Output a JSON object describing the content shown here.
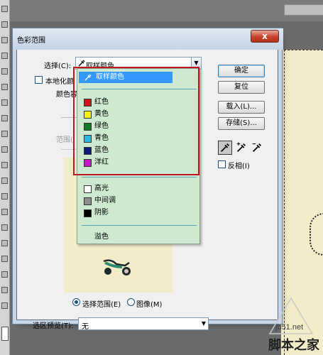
{
  "dialog": {
    "title": "色彩范围",
    "close_label": "x",
    "select_label": "选择(C):",
    "select_value": "取样颜色",
    "localize_label": "本地化颜",
    "fuzz_label": "颜色容",
    "range_label": "范围(",
    "radio_selection_label": "选择范围(E)",
    "radio_image_label": "图像(M)",
    "preview_label": "选区预览(T):",
    "preview_value": "无",
    "invert_label": "反相(I)"
  },
  "buttons": {
    "ok": "确定",
    "reset": "复位",
    "load": "载入(L)...",
    "save": "存储(S)..."
  },
  "dropdown": {
    "selected": "取样颜色",
    "colors": [
      {
        "label": "红色",
        "color": "#d4141c"
      },
      {
        "label": "黄色",
        "color": "#f5f01a"
      },
      {
        "label": "绿色",
        "color": "#0f7a23"
      },
      {
        "label": "青色",
        "color": "#27b8e3"
      },
      {
        "label": "蓝色",
        "color": "#0f1c7a"
      },
      {
        "label": "洋红",
        "color": "#c418c4"
      }
    ],
    "tones": [
      {
        "label": "高光",
        "color": "#ffffff"
      },
      {
        "label": "中间调",
        "color": "#8c8c8c"
      },
      {
        "label": "阴影",
        "color": "#000000"
      }
    ],
    "out_of_gamut": "溢色"
  },
  "watermark": {
    "url": "jb51.net",
    "text": "脚本之家"
  }
}
